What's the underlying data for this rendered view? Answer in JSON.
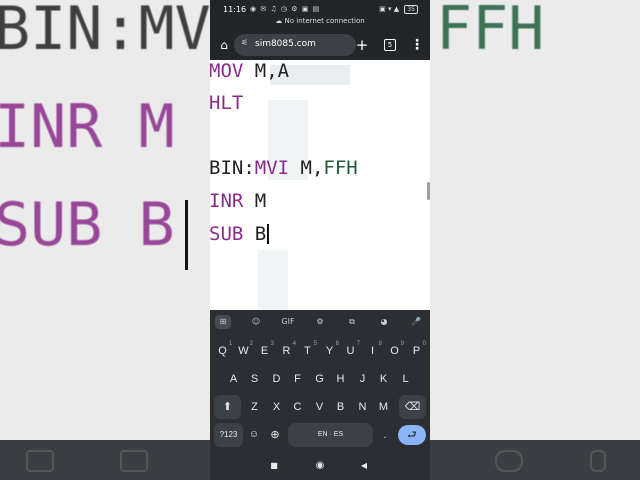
{
  "background": {
    "left_lines": [
      "BIN:MV",
      "INR M",
      "SUB B"
    ],
    "right_lines": [
      "FFH"
    ]
  },
  "status_bar": {
    "time": "11:16",
    "left_icons": "◉ ✉ ♫ ◷ ⚙ ▣ ▤",
    "right_icons": "▣ ▾ ▲",
    "battery": "35",
    "network_message": "No internet connection"
  },
  "browser": {
    "url": "sim8085.com",
    "tab_count": "5",
    "home_icon": "home-icon",
    "plus_icon": "plus-icon",
    "menu_icon": "menu-icon"
  },
  "editor": {
    "lines": [
      {
        "kw": "MOV",
        "args": " M,A",
        "num": ""
      },
      {
        "kw": "HLT",
        "args": "",
        "num": ""
      },
      {
        "label": "BIN:",
        "kw": "MVI",
        "args": " M,",
        "num": "FFH"
      },
      {
        "kw": "INR",
        "args": " M",
        "num": ""
      },
      {
        "kw": "SUB",
        "args": " B",
        "num": ""
      }
    ]
  },
  "keyboard": {
    "toolbar": [
      "⊞",
      "☺",
      "GIF",
      "⚙",
      "⧉",
      "◕",
      "🎤"
    ],
    "row1": [
      "Q",
      "W",
      "E",
      "R",
      "T",
      "Y",
      "U",
      "I",
      "O",
      "P"
    ],
    "row1_digits": [
      "1",
      "2",
      "3",
      "4",
      "5",
      "6",
      "7",
      "8",
      "9",
      "0"
    ],
    "row2": [
      "A",
      "S",
      "D",
      "F",
      "G",
      "H",
      "J",
      "K",
      "L"
    ],
    "row3": [
      "Z",
      "X",
      "C",
      "V",
      "B",
      "N",
      "M"
    ],
    "shift": "⬆",
    "backspace": "⌫",
    "symbols": "?123",
    "emoji": "☺",
    "globe": "⊕",
    "space": "EN · ES",
    "period": ".",
    "enter": "⮐"
  },
  "nav": {
    "square": "■",
    "circle": "◉",
    "back": "◀"
  },
  "colors": {
    "keyword": "#8a2a8a",
    "number": "#1f5d3a",
    "keyboard_bg": "#2b2f33",
    "enter": "#8ab4f8"
  }
}
